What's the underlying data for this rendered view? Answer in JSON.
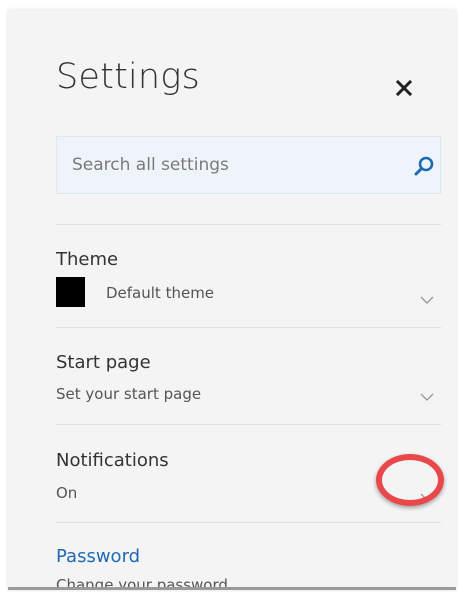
{
  "panel": {
    "title": "Settings"
  },
  "search": {
    "placeholder": "Search all settings",
    "value": ""
  },
  "sections": [
    {
      "title": "Theme",
      "subtitle": "Default theme",
      "swatch_color": "#000000"
    },
    {
      "title": "Start page",
      "subtitle": "Set your start page"
    },
    {
      "title": "Notifications",
      "subtitle": "On"
    },
    {
      "title": "Password",
      "subtitle": "Change your password",
      "is_link": true
    }
  ],
  "colors": {
    "panel_bg": "#f4f4f4",
    "search_bg": "#eef4fa",
    "link": "#1e6ab4",
    "search_icon": "#1e6ab4",
    "annotation": "#e8484b"
  },
  "icons": {
    "close": "close-icon",
    "search": "search-icon",
    "chevron": "chevron-down-icon"
  }
}
